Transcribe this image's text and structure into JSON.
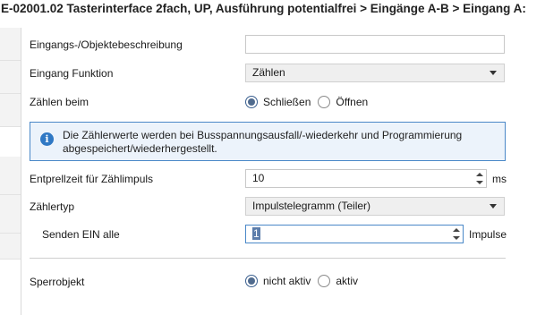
{
  "header": {
    "title": "E-02001.02 Tasterinterface 2fach, UP, Ausführung potentialfrei > Eingänge A-B > Eingang A:"
  },
  "fields": {
    "description": {
      "label": "Eingangs-/Objektebeschreibung",
      "value": ""
    },
    "function": {
      "label": "Eingang Funktion",
      "value": "Zählen"
    },
    "count_on": {
      "label": "Zählen beim",
      "options": [
        "Schließen",
        "Öffnen"
      ],
      "selected": "Schließen"
    },
    "info": {
      "icon": "info-icon",
      "text": "Die Zählerwerte werden bei Busspannungsausfall/-wiederkehr und Programmierung abgespeichert/wiederhergestellt."
    },
    "debounce": {
      "label": "Entprellzeit für Zählimpuls",
      "value": "10",
      "unit": "ms"
    },
    "counter_type": {
      "label": "Zählertyp",
      "value": "Impulstelegramm (Teiler)"
    },
    "send_on": {
      "label": "Senden EIN alle",
      "value": "1",
      "unit": "Impulse"
    },
    "lock_object": {
      "label": "Sperrobjekt",
      "options": [
        "nicht aktiv",
        "aktiv"
      ],
      "selected": "nicht aktiv"
    }
  },
  "colors": {
    "accent": "#4a88c8",
    "info_bg": "#ecf3fb",
    "selection": "#5c7dab"
  }
}
